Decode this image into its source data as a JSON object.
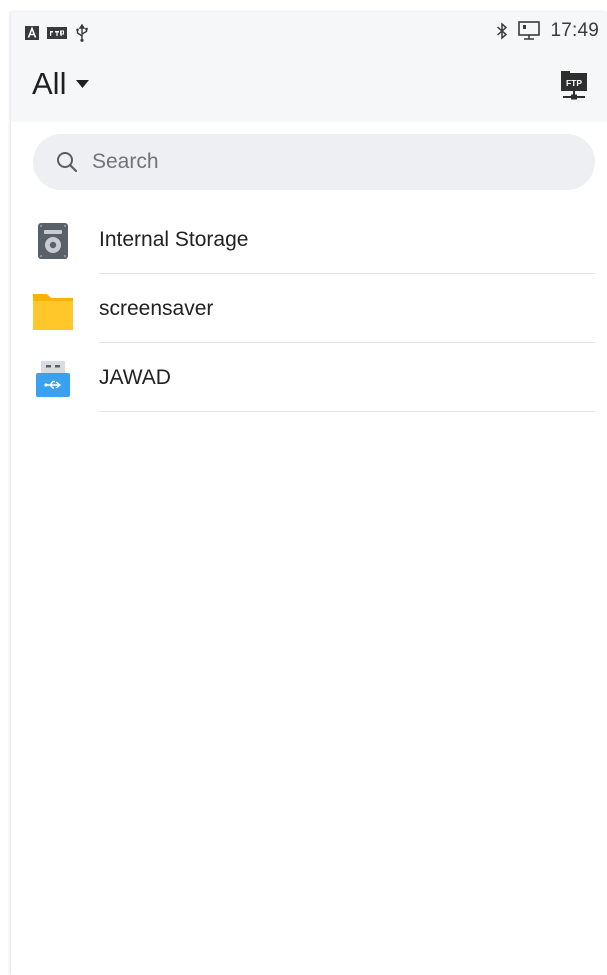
{
  "status_bar": {
    "time": "17:49",
    "left_icons": [
      "keyboard-a-icon",
      "ftp-small-icon",
      "usb-icon"
    ],
    "right_icons": [
      "bluetooth-icon",
      "ethernet-icon"
    ]
  },
  "app_bar": {
    "filter_label": "All",
    "filter_icon": "dropdown-arrow-icon",
    "ftp_button_icon": "ftp-server-icon",
    "ftp_badge_text": "FTP"
  },
  "search": {
    "placeholder": "Search",
    "value": ""
  },
  "storage_items": [
    {
      "label": "Internal Storage",
      "icon": "internal-storage-icon"
    },
    {
      "label": "screensaver",
      "icon": "folder-icon"
    },
    {
      "label": "JAWAD",
      "icon": "usb-drive-icon"
    }
  ],
  "colors": {
    "bar_background": "#f6f7f9",
    "search_background": "#edeff2",
    "folder_yellow": "#ffc729",
    "usb_blue": "#3aa0f0",
    "storage_gray": "#5a6068"
  }
}
